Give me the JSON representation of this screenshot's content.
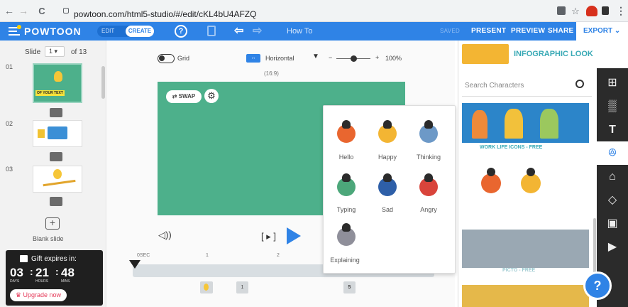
{
  "browser": {
    "back": "←",
    "forward": "→",
    "reload": "C",
    "url": "powtoon.com/html5-studio/#/edit/cKL4bU4AFZQ"
  },
  "toolbar": {
    "logo": "POWTOON",
    "edit": "EDIT",
    "create": "CREATE",
    "help": "?",
    "title": "How To",
    "saved": "SAVED",
    "present": "PRESENT",
    "preview": "PREVIEW",
    "share": "SHARE",
    "export": "EXPORT"
  },
  "slides": {
    "label": "Slide",
    "current": "1",
    "of": "of 13",
    "items": [
      {
        "num": "01",
        "caption": "OF YOUR TEXT"
      },
      {
        "num": "02"
      },
      {
        "num": "03"
      }
    ],
    "blank_label": "Blank slide"
  },
  "gift": {
    "title": "Gift expires in:",
    "days": "03",
    "hours": "21",
    "mins": "48",
    "days_l": "DAYS",
    "hours_l": "HOURS",
    "mins_l": "MINS",
    "upgrade": "Upgrade now"
  },
  "canvas": {
    "grid": "Grid",
    "orientation": "Horizontal",
    "zoom": "100%",
    "ratio": "(16:9)",
    "swap": "SWAP",
    "zoom_level": 0.75
  },
  "timeline": {
    "start": "0SEC",
    "t1": "1",
    "t2": "2",
    "marker1": "1",
    "marker2": "5"
  },
  "characters": {
    "items": [
      {
        "label": "Hello"
      },
      {
        "label": "Happy"
      },
      {
        "label": "Thinking"
      },
      {
        "label": "Typing"
      },
      {
        "label": "Sad"
      },
      {
        "label": "Angry"
      },
      {
        "label": "Explaining"
      }
    ]
  },
  "library": {
    "category": "INFOGRAPHIC LOOK",
    "search_placeholder": "Search Characters",
    "pack1": "WORK LIFE ICONS - FREE",
    "pack2": "PICTO - FREE"
  },
  "colors": {
    "brand_blue": "#2f83e6",
    "stage_green": "#4db08b",
    "accent_teal": "#38a9b5",
    "upgrade_red": "#e53b5a"
  },
  "icons": [
    "back-icon",
    "forward-icon",
    "reload-icon",
    "lock-icon",
    "translate-icon",
    "star-icon",
    "extension-icon",
    "puzzle-icon",
    "menu-icon",
    "help-icon",
    "notes-icon",
    "undo-icon",
    "redo-icon",
    "layout-icon",
    "pattern-icon",
    "text-icon",
    "characters-icon",
    "props-icon",
    "shapes-icon",
    "media-icon",
    "video-icon",
    "gift-icon",
    "speaker-icon",
    "play-icon",
    "search-icon"
  ]
}
